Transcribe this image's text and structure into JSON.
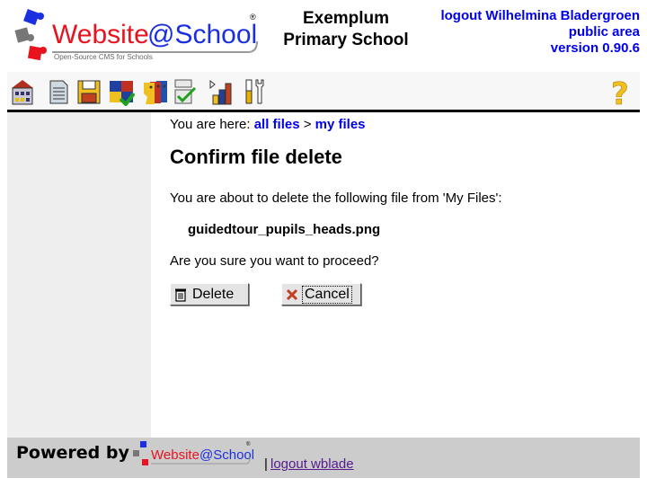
{
  "header": {
    "logo_text_main": "Website",
    "logo_text_at": "@School",
    "logo_tagline": "Open-Source CMS for Schools",
    "school_title_line1": "Exemplum",
    "school_title_line2": "Primary School",
    "logout_link": "logout Wilhelmina Bladergroen",
    "area_link": "public area",
    "version": "version 0.90.6"
  },
  "toolbar": {
    "items": [
      {
        "icon": "house-icon",
        "label": "start"
      },
      {
        "icon": "page-icon",
        "label": "pagemanager"
      },
      {
        "icon": "floppy-disk-icon",
        "label": "filemanager"
      },
      {
        "icon": "puzzle-modules-icon",
        "label": "modules"
      },
      {
        "icon": "users-faces-icon",
        "label": "accountmanager"
      },
      {
        "icon": "checklist-icon",
        "label": "configurationmanager"
      },
      {
        "icon": "bar-chart-icon",
        "label": "statistics"
      },
      {
        "icon": "tools-icon",
        "label": "tools"
      }
    ],
    "help_icon": "question-mark-icon"
  },
  "breadcrumb": {
    "prefix": "You are here: ",
    "items": [
      "all files",
      "my files"
    ],
    "separator": " > "
  },
  "main": {
    "heading": "Confirm file delete",
    "intro": "You are about to delete the following file from 'My Files':",
    "filename": "guidedtour_pupils_heads.png",
    "question": "Are you sure you want to proceed?",
    "delete_label": "Delete",
    "cancel_label": "Cancel"
  },
  "footer": {
    "powered_by": "Powered by",
    "separator": "|",
    "logout_link": "logout wblade"
  },
  "colors": {
    "link": "#0000ee",
    "visited_link": "#551a8b",
    "sidebar_bg": "#eeeeee",
    "footer_bg": "#cccccc",
    "logo_red": "#e8131f",
    "logo_blue": "#1a2fe0"
  }
}
